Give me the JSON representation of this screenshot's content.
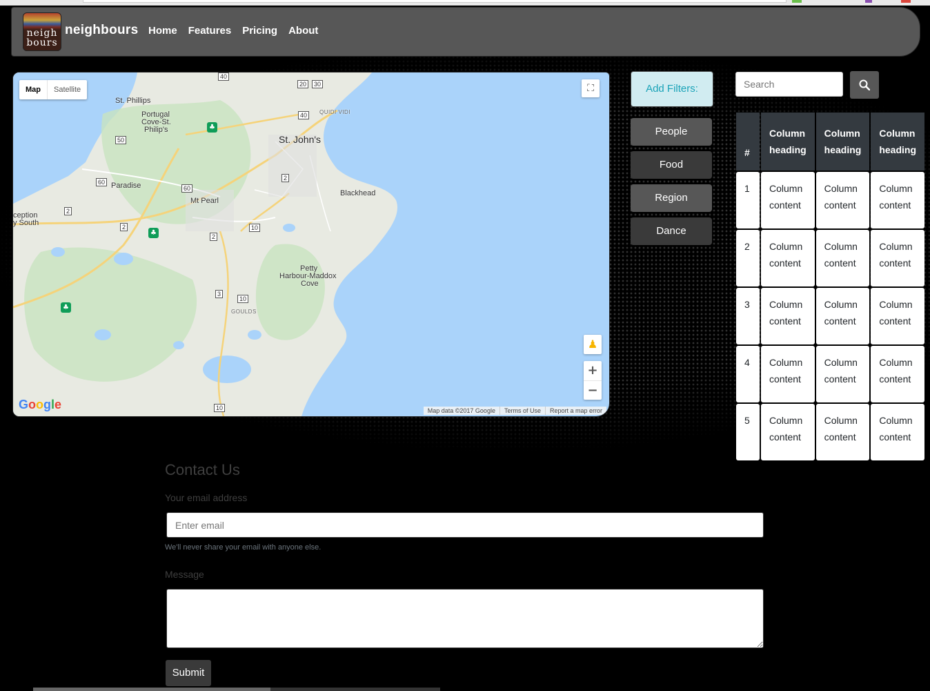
{
  "navbar": {
    "logo_line1": "neigh",
    "logo_line2": "bours",
    "brand": "neighbours",
    "links": [
      "Home",
      "Features",
      "Pricing",
      "About"
    ]
  },
  "map": {
    "type_map": "Map",
    "type_satellite": "Satellite",
    "labels": {
      "st_phillips": "St. Phillips",
      "portugal_cove_1": "Portugal",
      "portugal_cove_2": "Cove-St.",
      "portugal_cove_3": "Philip's",
      "st_johns": "St. John's",
      "quidi_vidi": "QUIDI VIDI",
      "paradise": "Paradise",
      "mt_pearl": "Mt Pearl",
      "blackhead": "Blackhead",
      "conception_1": "ception",
      "conception_2": "y South",
      "petty_1": "Petty",
      "petty_2": "Harbour-Maddox",
      "petty_3": "Cove",
      "goulds": "GOULDS"
    },
    "shields": [
      "40",
      "20",
      "30",
      "40",
      "50",
      "60",
      "60",
      "2",
      "2",
      "2",
      "10",
      "2",
      "3",
      "10",
      "10"
    ],
    "attribution": [
      "Map data ©2017 Google",
      "Terms of Use",
      "Report a map error"
    ]
  },
  "filters": {
    "title": "Add Filters:",
    "buttons": [
      "People",
      "Food",
      "Region",
      "Dance"
    ]
  },
  "search": {
    "placeholder": "Search"
  },
  "table": {
    "headers": [
      "#",
      "Column heading",
      "Column heading",
      "Column heading"
    ],
    "rows": [
      [
        "1",
        "Column content",
        "Column content",
        "Column content"
      ],
      [
        "2",
        "Column content",
        "Column content",
        "Column content"
      ],
      [
        "3",
        "Column content",
        "Column content",
        "Column content"
      ],
      [
        "4",
        "Column content",
        "Column content",
        "Column content"
      ],
      [
        "5",
        "Column content",
        "Column content",
        "Column content"
      ]
    ]
  },
  "contact": {
    "title": "Contact Us",
    "email_label": "Your email address",
    "email_placeholder": "Enter email",
    "help": "We'll never share your email with anyone else.",
    "message_label": "Message",
    "submit": "Submit"
  },
  "colors": {
    "background": "#000000",
    "navbar": "#575757",
    "filter_title_bg": "#d1ecf1",
    "filter_title_text": "#1aa3b8",
    "table_header": "#343a40",
    "water": "#aad3fa"
  }
}
